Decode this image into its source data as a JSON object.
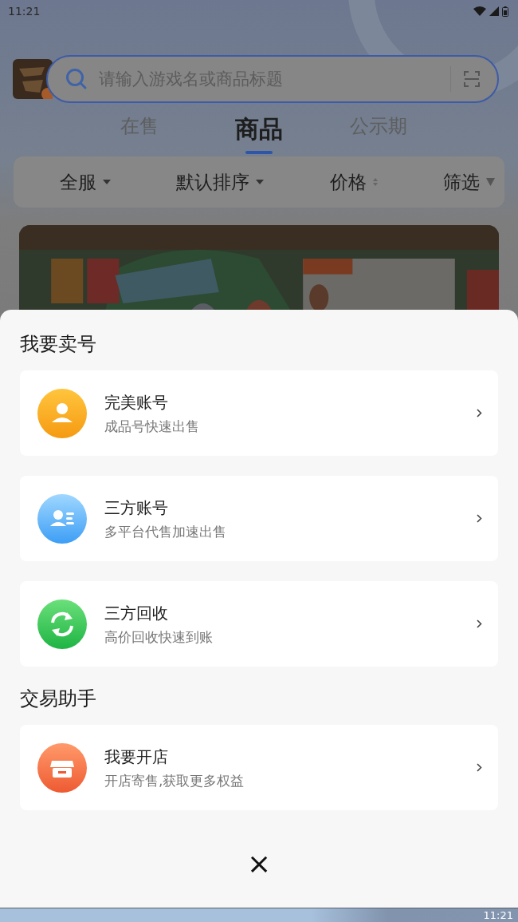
{
  "status_bar": {
    "time": "11:21"
  },
  "search": {
    "placeholder": "请输入游戏名或商品标题"
  },
  "tabs": [
    {
      "label": "在售",
      "selected": false
    },
    {
      "label": "商品",
      "selected": true
    },
    {
      "label": "公示期",
      "selected": false
    }
  ],
  "filters": [
    {
      "label": "全服",
      "kind": "dropdown"
    },
    {
      "label": "默认排序",
      "kind": "dropdown"
    },
    {
      "label": "价格",
      "kind": "sort"
    },
    {
      "label": "筛选",
      "kind": "filter"
    }
  ],
  "sheet": {
    "sections": [
      {
        "title": "我要卖号",
        "items": [
          {
            "title": "完美账号",
            "subtitle": "成品号快速出售",
            "kind": "person"
          },
          {
            "title": "三方账号",
            "subtitle": "多平台代售加速出售",
            "kind": "contact"
          },
          {
            "title": "三方回收",
            "subtitle": "高价回收快速到账",
            "kind": "recycle"
          }
        ]
      },
      {
        "title": "交易助手",
        "items": [
          {
            "title": "我要开店",
            "subtitle": "开店寄售,获取更多权益",
            "kind": "shop"
          }
        ]
      }
    ],
    "close": "×"
  },
  "taskbar": {
    "time": "11:21"
  }
}
